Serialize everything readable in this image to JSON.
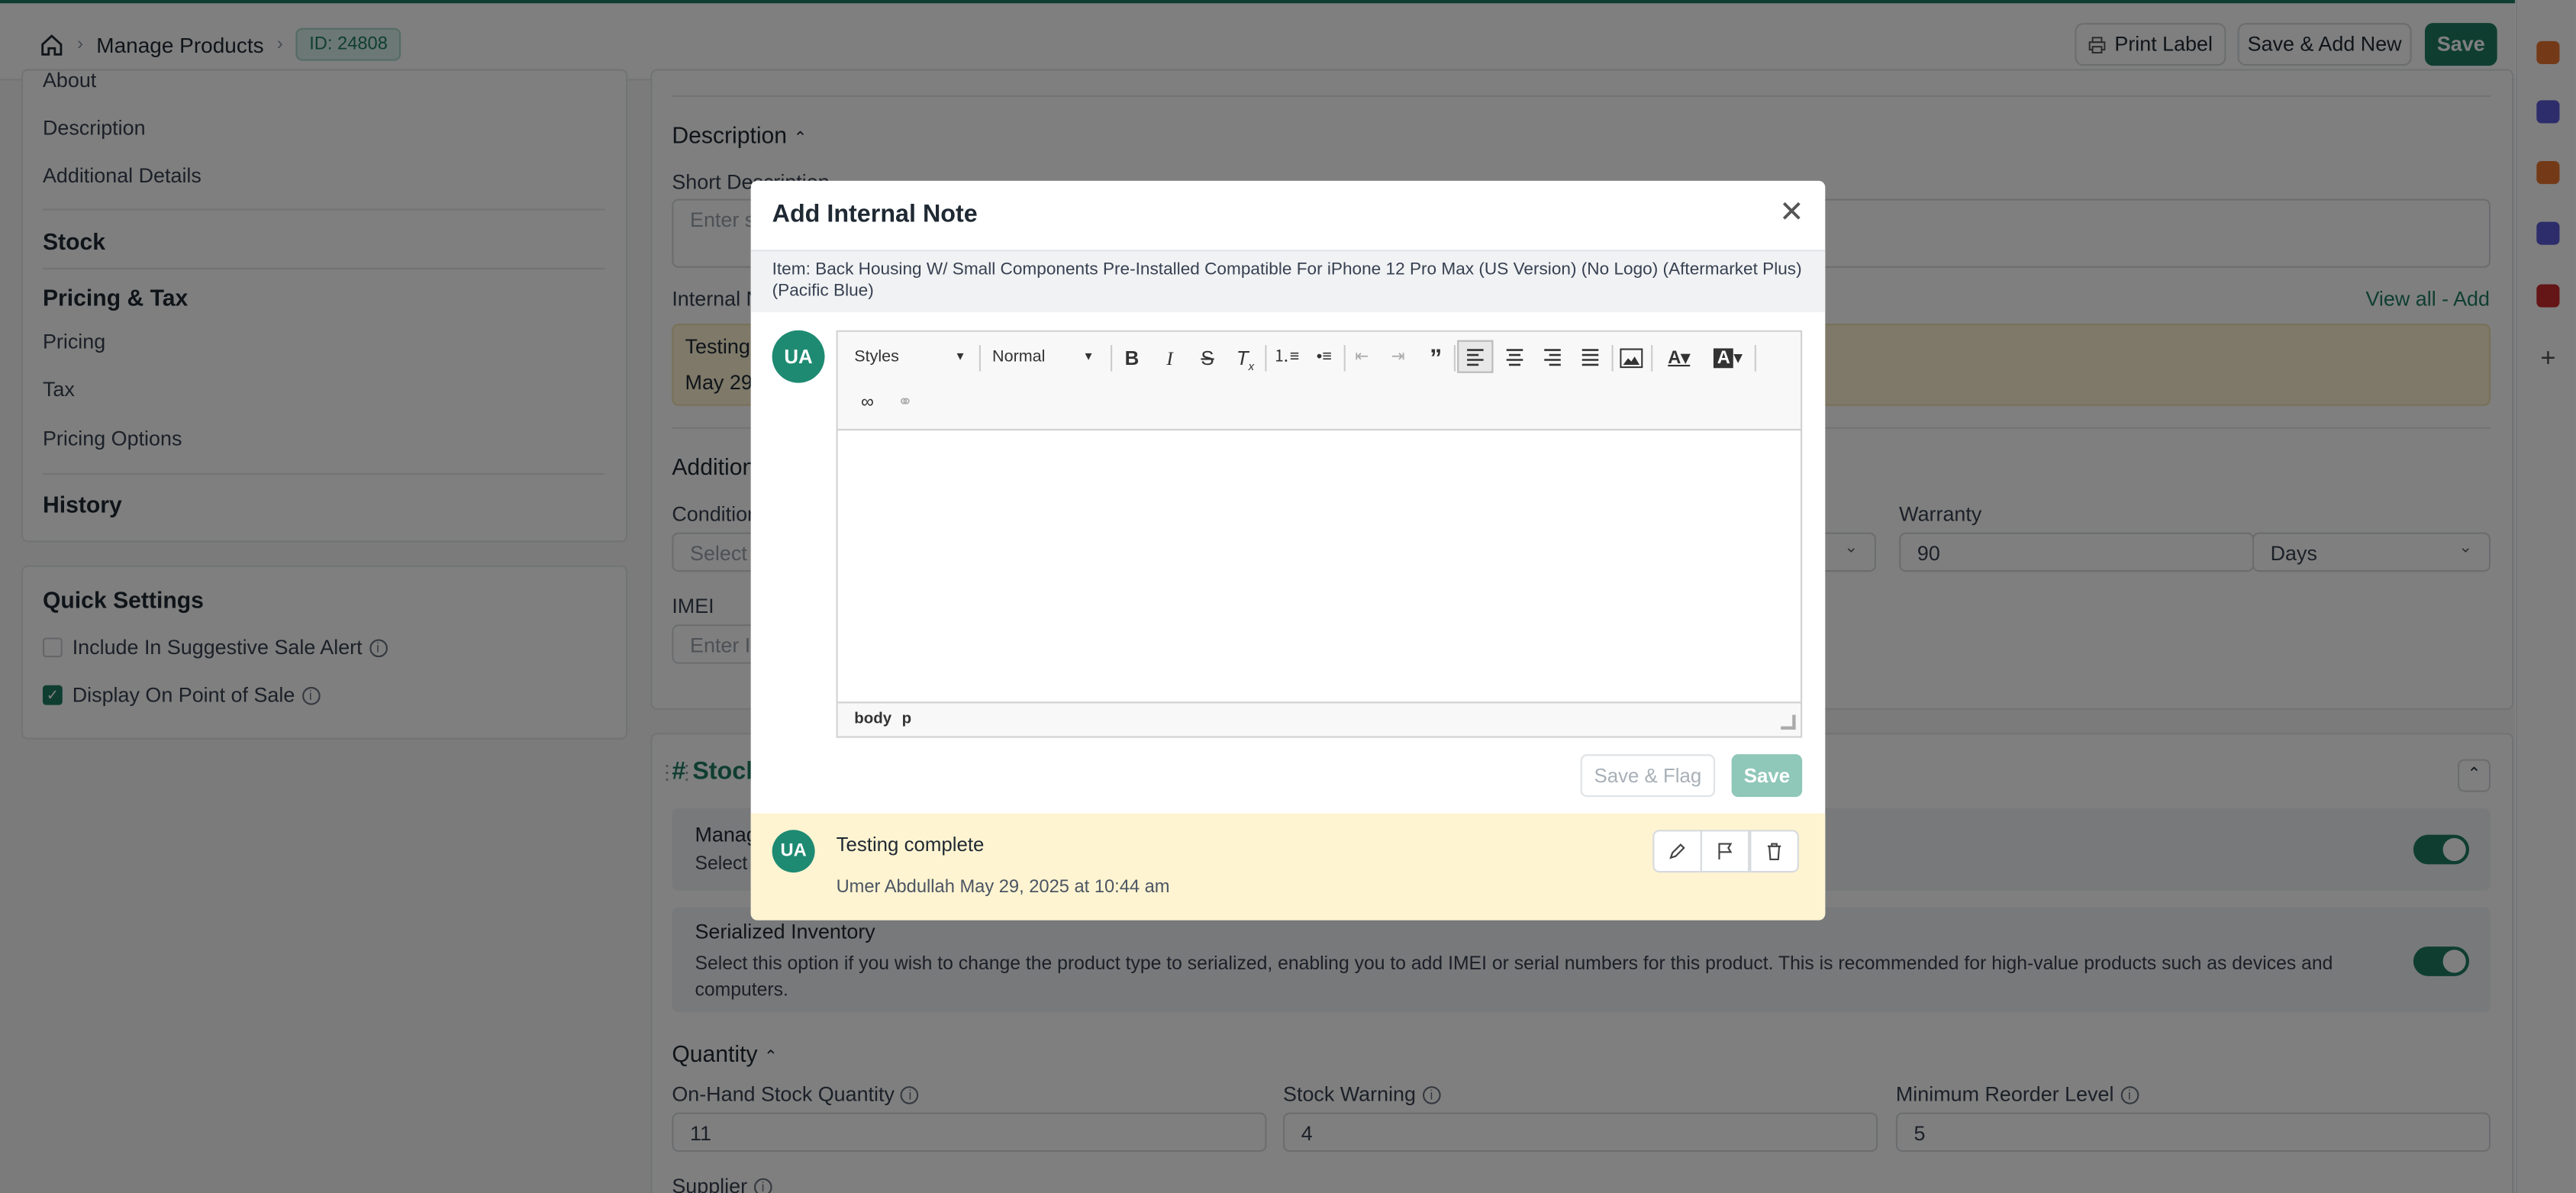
{
  "header": {
    "breadcrumb_page": "Manage Products",
    "id_badge": "ID: 24808",
    "print_label": "Print Label",
    "save_add_new": "Save & Add New",
    "save": "Save"
  },
  "sidebar": {
    "partial_item": "About",
    "items_product": [
      "Description",
      "Additional Details"
    ],
    "stock": "Stock",
    "pricing_tax": "Pricing & Tax",
    "items_pricing": [
      "Pricing",
      "Tax",
      "Pricing Options"
    ],
    "history": "History"
  },
  "quick_settings": {
    "title": "Quick Settings",
    "opt1": "Include In Suggestive Sale Alert",
    "opt2": "Display On Point of Sale"
  },
  "main": {
    "description_title": "Description",
    "short_desc_label": "Short Description",
    "short_desc_ph": "Enter s",
    "internal_label": "Internal N",
    "view_all": "View all - Add",
    "note_preview_1": "Testing",
    "note_preview_2": "May 29",
    "additional_title": "Addition",
    "condition_label": "Condition",
    "condition_ph": "Select",
    "warranty_label": "Warranty",
    "warranty_value": "90",
    "warranty_unit": "Days",
    "imei_label": "IMEI",
    "imei_ph": "Enter IM",
    "stock_title": "# Stock",
    "manage_label": "Manag",
    "manage_sub": "Select",
    "serialized_title": "Serialized Inventory",
    "serialized_desc": "Select this option if you wish to change the product type to serialized, enabling you to add IMEI or serial numbers for this product. This is recommended for high-value products such as devices and computers.",
    "quantity_title": "Quantity",
    "onhand_label": "On-Hand Stock Quantity",
    "onhand_value": "11",
    "warning_label": "Stock Warning",
    "warning_value": "4",
    "reorder_label": "Minimum Reorder Level",
    "reorder_value": "5",
    "supplier_label": "Supplier"
  },
  "modal": {
    "title": "Add Internal Note",
    "item": "Item: Back Housing W/ Small Components Pre-Installed Compatible For iPhone 12 Pro Max (US Version) (No Logo) (Aftermarket Plus) (Pacific Blue)",
    "avatar": "UA",
    "styles": "Styles",
    "format": "Normal",
    "path_body": "body",
    "path_p": "p",
    "save_flag": "Save & Flag",
    "save": "Save",
    "note_text": "Testing complete",
    "note_meta": "Umer Abdullah May 29, 2025 at 10:44 am"
  },
  "colors": {
    "accent": "#1e7d62",
    "note_bg": "#fff4d1"
  }
}
